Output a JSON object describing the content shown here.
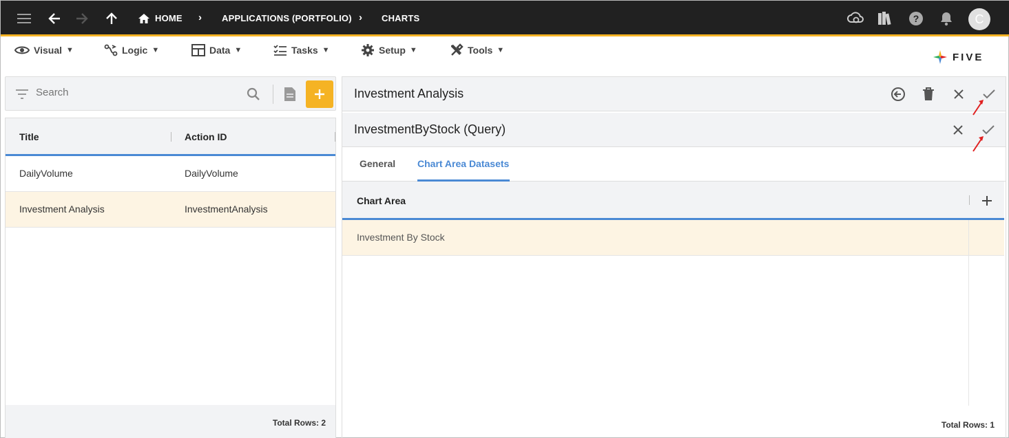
{
  "topbar": {
    "breadcrumbs": [
      "HOME",
      "APPLICATIONS (PORTFOLIO)",
      "CHARTS"
    ],
    "avatar_initial": "C"
  },
  "menu": {
    "items": [
      {
        "label": "Visual",
        "icon": "eye-icon"
      },
      {
        "label": "Logic",
        "icon": "logic-icon"
      },
      {
        "label": "Data",
        "icon": "table-icon"
      },
      {
        "label": "Tasks",
        "icon": "checklist-icon"
      },
      {
        "label": "Setup",
        "icon": "gear-icon"
      },
      {
        "label": "Tools",
        "icon": "tools-icon"
      }
    ],
    "caret": "▼"
  },
  "logo": {
    "text": "FIVE"
  },
  "left": {
    "search_placeholder": "Search",
    "columns": [
      "Title",
      "Action ID"
    ],
    "rows": [
      {
        "title": "DailyVolume",
        "action_id": "DailyVolume"
      },
      {
        "title": "Investment Analysis",
        "action_id": "InvestmentAnalysis"
      }
    ],
    "total_rows": "Total Rows: 2"
  },
  "right": {
    "title": "Investment Analysis",
    "sub_title": "InvestmentByStock (Query)",
    "tabs": [
      "General",
      "Chart Area Datasets"
    ],
    "active_tab": "Chart Area Datasets",
    "column": "Chart Area",
    "rows": [
      "Investment By Stock"
    ],
    "total_rows": "Total Rows: 1"
  },
  "colors": {
    "accent": "#f5b324",
    "topbar": "#212121",
    "tab_active": "#4a89d4",
    "selected_row": "#fdf4e3",
    "annotation_arrow": "#e02020"
  }
}
